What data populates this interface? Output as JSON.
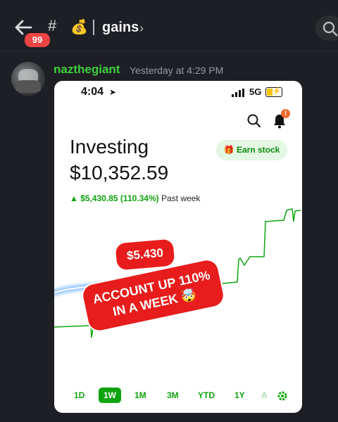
{
  "header": {
    "unread_count": "99",
    "hash": "#",
    "channel_emoji": "💰",
    "channel_name": "gains",
    "chevron": "›"
  },
  "message": {
    "username": "nazthegiant",
    "timestamp": "Yesterday at 4:29 PM",
    "username_color": "#3ecf3e"
  },
  "screenshot": {
    "status_time": "4:04",
    "network": "5G",
    "title": "Investing",
    "balance": "$10,352.59",
    "earn_stock_label": "Earn stock",
    "change_amount": "▲ $5,430.85 (110.34%)",
    "change_period": "Past week",
    "notification_count": "!",
    "sticker_amount": "$5.430",
    "sticker_line1": "ACCOUNT UP 110%",
    "sticker_line2": "IN A WEEK 🤯",
    "ranges": [
      "1D",
      "1W",
      "1M",
      "3M",
      "YTD",
      "1Y",
      "A"
    ],
    "active_range": "1W",
    "accent_color": "#0fa30f",
    "sticker_color": "#e81c1c"
  },
  "icons": [
    "back-arrow-icon",
    "search-icon",
    "location-arrow-icon",
    "signal-icon",
    "battery-icon",
    "bell-icon",
    "gift-icon",
    "gear-icon"
  ]
}
